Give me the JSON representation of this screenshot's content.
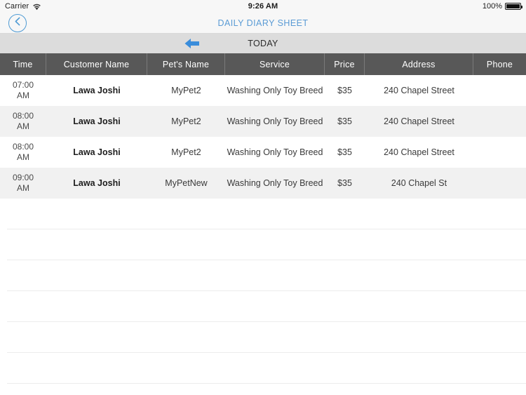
{
  "status_bar": {
    "carrier": "Carrier",
    "wifi_icon": "wifi-icon",
    "time": "9:26 AM",
    "battery_percent": "100%",
    "battery_icon": "battery-full-icon"
  },
  "nav_bar": {
    "back_icon": "chevron-left-circle-icon",
    "title": "DAILY DIARY SHEET"
  },
  "today_bar": {
    "prev_icon": "arrow-left-icon",
    "label": "TODAY"
  },
  "table": {
    "columns": [
      {
        "key": "time",
        "label": "Time"
      },
      {
        "key": "customer",
        "label": "Customer Name"
      },
      {
        "key": "pet",
        "label": "Pet's Name"
      },
      {
        "key": "service",
        "label": "Service"
      },
      {
        "key": "price",
        "label": "Price"
      },
      {
        "key": "address",
        "label": "Address"
      },
      {
        "key": "phone",
        "label": "Phone"
      }
    ],
    "rows": [
      {
        "time": "07:00\nAM",
        "customer": "Lawa Joshi",
        "pet": "MyPet2",
        "service": "Washing Only Toy Breed",
        "price": "$35",
        "address": "240 Chapel Street",
        "phone": ""
      },
      {
        "time": "08:00\nAM",
        "customer": "Lawa Joshi",
        "pet": "MyPet2",
        "service": "Washing Only Toy Breed",
        "price": "$35",
        "address": "240 Chapel Street",
        "phone": ""
      },
      {
        "time": "08:00\nAM",
        "customer": "Lawa Joshi",
        "pet": "MyPet2",
        "service": "Washing Only Toy Breed",
        "price": "$35",
        "address": "240 Chapel Street",
        "phone": ""
      },
      {
        "time": "09:00\nAM",
        "customer": "Lawa Joshi",
        "pet": "MyPetNew",
        "service": "Washing Only Toy Breed",
        "price": "$35",
        "address": "240 Chapel St",
        "phone": ""
      }
    ],
    "empty_row_count": 6
  },
  "colors": {
    "accent_blue": "#5a9bd5",
    "arrow_blue": "#3a8ddb",
    "header_bg": "#585858",
    "today_bg": "#dcdcdc",
    "bar_bg": "#f7f7f7",
    "row_alt": "#f1f1f1",
    "separator": "#ececec"
  }
}
